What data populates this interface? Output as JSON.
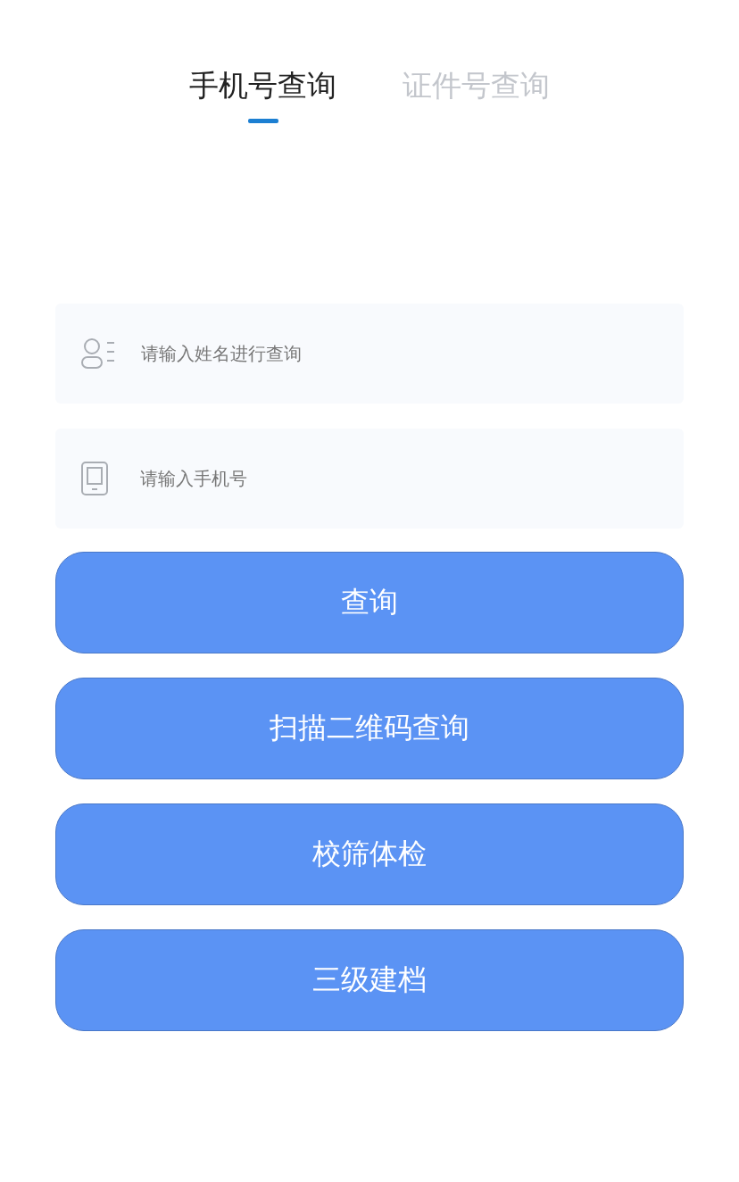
{
  "tabs": [
    {
      "label": "手机号查询",
      "selected": true
    },
    {
      "label": "证件号查询",
      "selected": false
    }
  ],
  "fields": [
    {
      "kind": "name",
      "placeholder": "请输入姓名进行查询"
    },
    {
      "kind": "phone",
      "placeholder": "请输入手机号"
    }
  ],
  "buttons": [
    "查询",
    "扫描二维码查询",
    "校筛体检",
    "三级建档"
  ]
}
